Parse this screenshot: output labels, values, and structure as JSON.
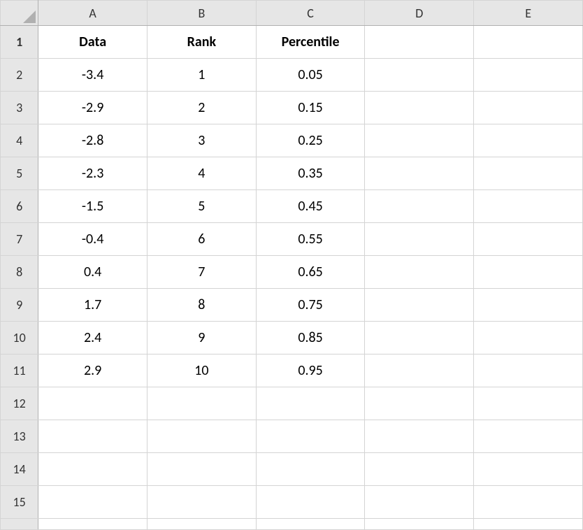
{
  "columns": [
    "A",
    "B",
    "C",
    "D",
    "E"
  ],
  "row_numbers": [
    "1",
    "2",
    "3",
    "4",
    "5",
    "6",
    "7",
    "8",
    "9",
    "10",
    "11",
    "12",
    "13",
    "14",
    "15"
  ],
  "headers": {
    "A": "Data",
    "B": "Rank",
    "C": "Percentile",
    "D": "",
    "E": ""
  },
  "rows": [
    {
      "A": "-3.4",
      "B": "1",
      "C": "0.05",
      "D": "",
      "E": ""
    },
    {
      "A": "-2.9",
      "B": "2",
      "C": "0.15",
      "D": "",
      "E": ""
    },
    {
      "A": "-2.8",
      "B": "3",
      "C": "0.25",
      "D": "",
      "E": ""
    },
    {
      "A": "-2.3",
      "B": "4",
      "C": "0.35",
      "D": "",
      "E": ""
    },
    {
      "A": "-1.5",
      "B": "5",
      "C": "0.45",
      "D": "",
      "E": ""
    },
    {
      "A": "-0.4",
      "B": "6",
      "C": "0.55",
      "D": "",
      "E": ""
    },
    {
      "A": "0.4",
      "B": "7",
      "C": "0.65",
      "D": "",
      "E": ""
    },
    {
      "A": "1.7",
      "B": "8",
      "C": "0.75",
      "D": "",
      "E": ""
    },
    {
      "A": "2.4",
      "B": "9",
      "C": "0.85",
      "D": "",
      "E": ""
    },
    {
      "A": "2.9",
      "B": "10",
      "C": "0.95",
      "D": "",
      "E": ""
    },
    {
      "A": "",
      "B": "",
      "C": "",
      "D": "",
      "E": ""
    },
    {
      "A": "",
      "B": "",
      "C": "",
      "D": "",
      "E": ""
    },
    {
      "A": "",
      "B": "",
      "C": "",
      "D": "",
      "E": ""
    },
    {
      "A": "",
      "B": "",
      "C": "",
      "D": "",
      "E": ""
    }
  ],
  "chart_data": {
    "type": "table",
    "columns": [
      "Data",
      "Rank",
      "Percentile"
    ],
    "data": [
      {
        "Data": -3.4,
        "Rank": 1,
        "Percentile": 0.05
      },
      {
        "Data": -2.9,
        "Rank": 2,
        "Percentile": 0.15
      },
      {
        "Data": -2.8,
        "Rank": 3,
        "Percentile": 0.25
      },
      {
        "Data": -2.3,
        "Rank": 4,
        "Percentile": 0.35
      },
      {
        "Data": -1.5,
        "Rank": 5,
        "Percentile": 0.45
      },
      {
        "Data": -0.4,
        "Rank": 6,
        "Percentile": 0.55
      },
      {
        "Data": 0.4,
        "Rank": 7,
        "Percentile": 0.65
      },
      {
        "Data": 1.7,
        "Rank": 8,
        "Percentile": 0.75
      },
      {
        "Data": 2.4,
        "Rank": 9,
        "Percentile": 0.85
      },
      {
        "Data": 2.9,
        "Rank": 10,
        "Percentile": 0.95
      }
    ]
  }
}
